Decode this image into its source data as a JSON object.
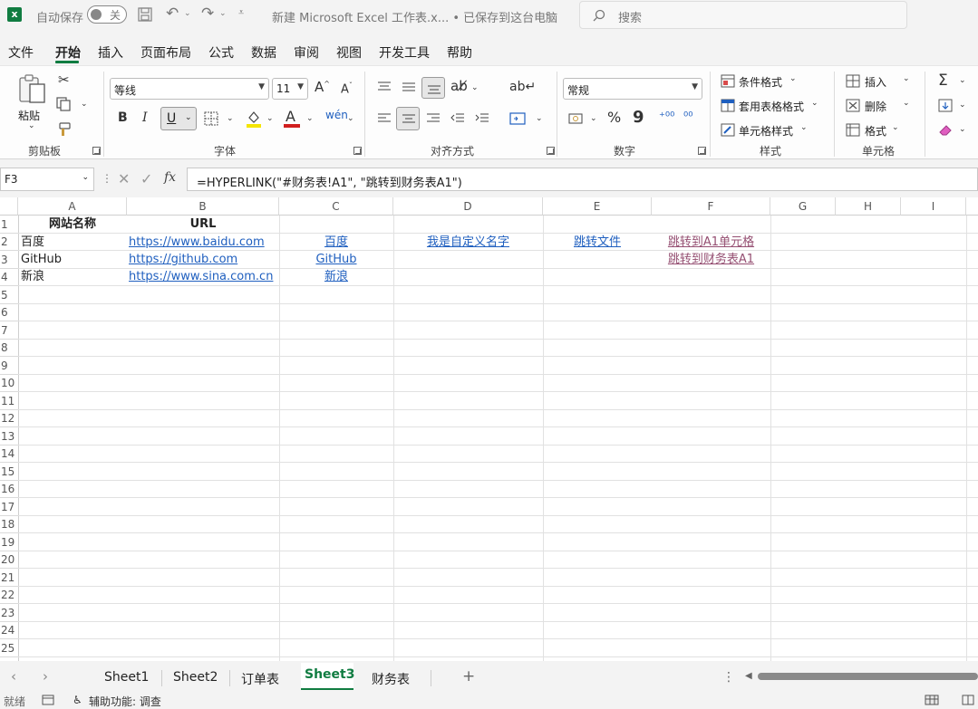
{
  "titlebar": {
    "autosave_label": "自动保存",
    "autosave_state": "关",
    "document_title": "新建 Microsoft Excel 工作表.x... • 已保存到这台电脑",
    "search_placeholder": "搜索"
  },
  "menu": {
    "tabs": [
      "文件",
      "开始",
      "插入",
      "页面布局",
      "公式",
      "数据",
      "审阅",
      "视图",
      "开发工具",
      "帮助"
    ],
    "active_tab": "开始"
  },
  "ribbon": {
    "clipboard": {
      "paste_label": "粘贴",
      "group_label": "剪贴板"
    },
    "font": {
      "font_name": "等线",
      "font_size": "11",
      "bold": "B",
      "italic": "I",
      "underline": "U",
      "grow": "A",
      "shrink": "A",
      "font_color_glyph": "A",
      "group_label": "字体"
    },
    "alignment": {
      "group_label": "对齐方式"
    },
    "number": {
      "format": "常规",
      "percent": "%",
      "comma": "9",
      "group_label": "数字"
    },
    "styles": {
      "conditional": "条件格式",
      "table_format": "套用表格格式",
      "cell_styles": "单元格样式",
      "group_label": "样式"
    },
    "cells": {
      "insert": "插入",
      "delete": "删除",
      "format": "格式",
      "group_label": "单元格"
    },
    "accent_color": "#107c41"
  },
  "formula_bar": {
    "name_box": "F3",
    "fx": "fx",
    "formula": "=HYPERLINK(\"#财务表!A1\", \"跳转到财务表A1\")"
  },
  "grid": {
    "columns": [
      "A",
      "B",
      "C",
      "D",
      "E",
      "F",
      "G",
      "H",
      "I"
    ],
    "rows": [
      "1",
      "2",
      "3",
      "4",
      "5",
      "6",
      "7",
      "8",
      "9",
      "10",
      "11",
      "12",
      "13",
      "14",
      "15",
      "16",
      "17",
      "18",
      "19",
      "20",
      "21",
      "22",
      "23",
      "24",
      "25"
    ],
    "cells": {
      "A1": "网站名称",
      "B1": "URL",
      "A2": "百度",
      "B2": "https://www.baidu.com",
      "C2": "百度",
      "D2": "我是自定义名字",
      "E2": "跳转文件",
      "F2": "跳转到A1单元格",
      "A3": "GitHub",
      "B3": "https://github.com",
      "C3": "GitHub",
      "F3": "跳转到财务表A1",
      "A4": "新浪",
      "B4": "https://www.sina.com.cn",
      "C4": "新浪"
    },
    "link_color": "#1f5fbf",
    "visited_link_color": "#954f72"
  },
  "sheet_tabs": {
    "tabs": [
      "Sheet1",
      "Sheet2",
      "订单表",
      "Sheet3",
      "财务表"
    ],
    "active": "Sheet3",
    "add_glyph": "+"
  },
  "status_bar": {
    "ready": "就绪",
    "accessibility": "辅助功能: 调查"
  }
}
